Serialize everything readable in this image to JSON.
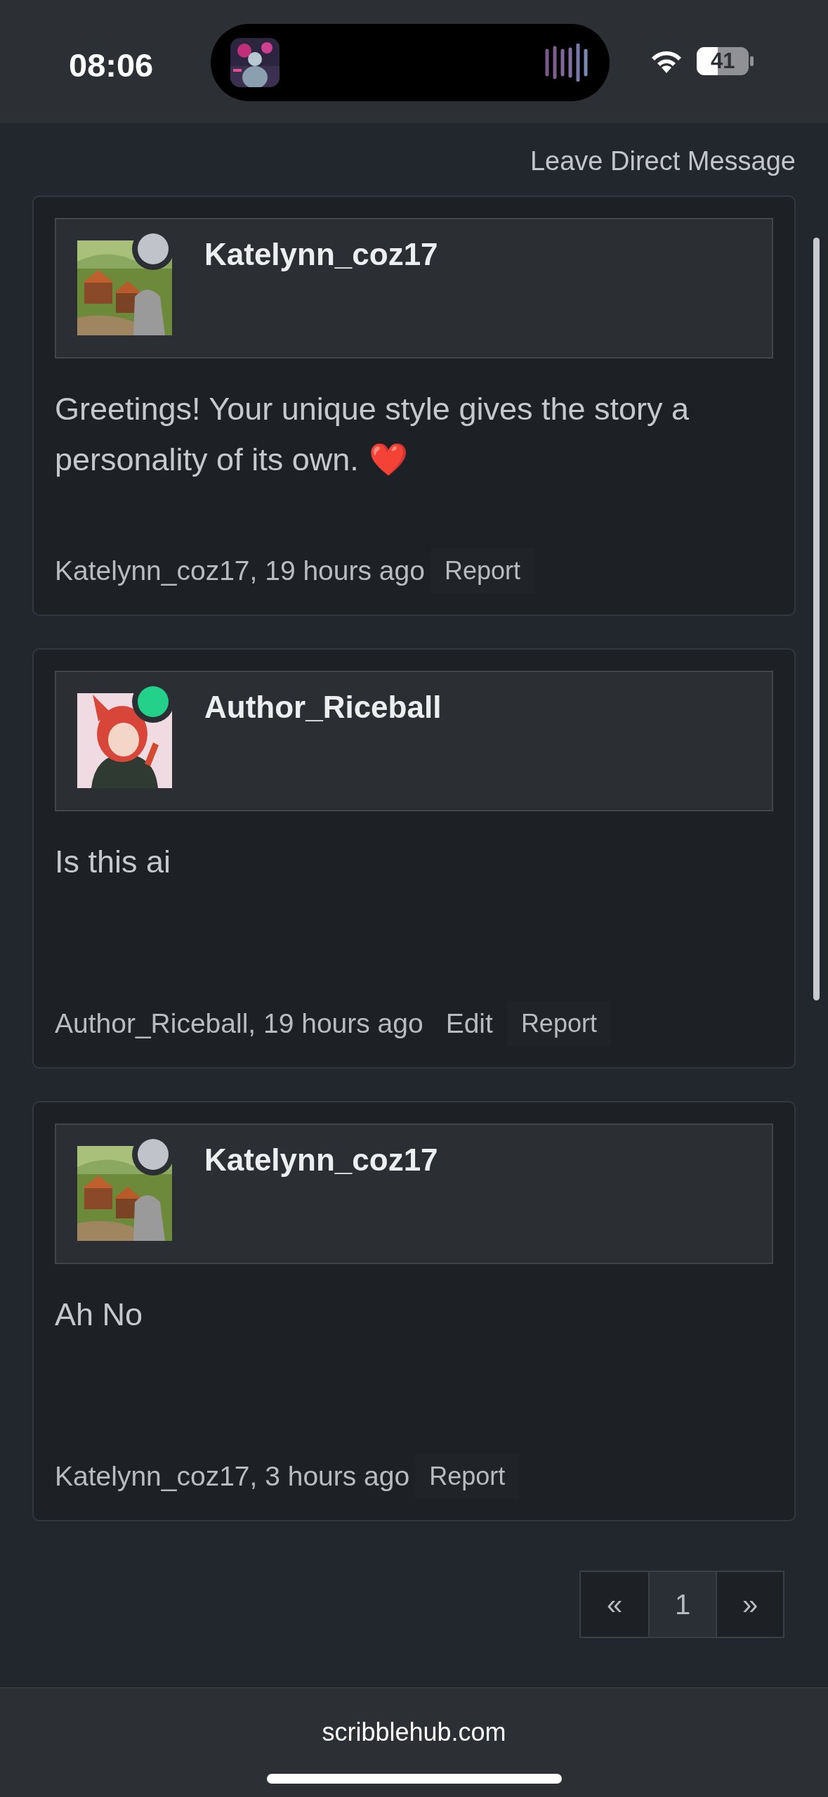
{
  "status_bar": {
    "time": "08:06",
    "battery": "41"
  },
  "page": {
    "direct_message_link": "Leave Direct Message"
  },
  "comments": [
    {
      "author": "Katelynn_coz17",
      "online": false,
      "avatar": {
        "kind": "picture"
      },
      "body": "Greetings! Your unique style gives the story a personality of its own.",
      "emoji": "❤️",
      "meta": "Katelynn_coz17, 19 hours ago",
      "actions": [
        {
          "label": "Report",
          "kind": "report"
        }
      ]
    },
    {
      "author": "Author_Riceball",
      "online": true,
      "avatar": {
        "kind": "picture"
      },
      "body": "Is this ai",
      "meta": "Author_Riceball, 19 hours ago",
      "actions": [
        {
          "label": "Edit",
          "kind": "edit"
        },
        {
          "label": "Report",
          "kind": "report"
        }
      ]
    },
    {
      "author": "Katelynn_coz17",
      "online": false,
      "avatar": {
        "kind": "picture"
      },
      "body": "Ah No",
      "meta": "Katelynn_coz17, 3 hours ago",
      "actions": [
        {
          "label": "Report",
          "kind": "report"
        }
      ]
    }
  ],
  "pagination": [
    {
      "label": "«",
      "selected": false
    },
    {
      "label": "1",
      "selected": true
    },
    {
      "label": "»",
      "selected": false
    }
  ],
  "browser_bar": {
    "url": "scribblehub.com"
  }
}
